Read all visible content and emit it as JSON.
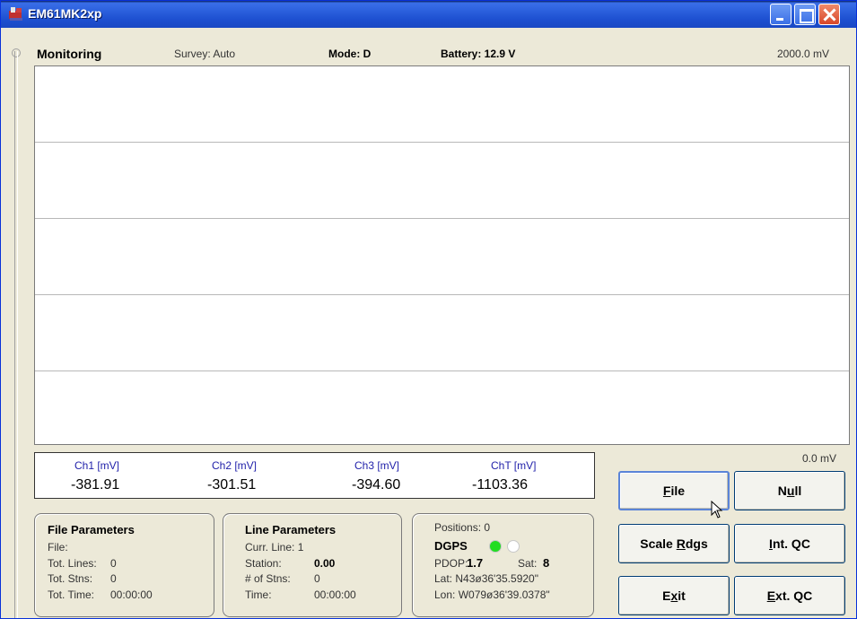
{
  "window": {
    "title": "EM61MK2xp"
  },
  "status": {
    "title": "Monitoring",
    "survey": "Survey: Auto",
    "mode": "Mode: D",
    "battery": "Battery: 12.9 V",
    "scale_max": "2000.0 mV",
    "scale_min": "0.0 mV"
  },
  "channels": [
    {
      "label": "Ch1 [mV]",
      "value": "-381.91"
    },
    {
      "label": "Ch2 [mV]",
      "value": "-301.51"
    },
    {
      "label": "Ch3 [mV]",
      "value": "-394.60"
    },
    {
      "label": "ChT [mV]",
      "value": "-1103.36"
    }
  ],
  "file_params": {
    "title": "File Parameters",
    "file_label": "File:",
    "tot_lines_label": "Tot. Lines:",
    "tot_lines_value": "0",
    "tot_stns_label": "Tot. Stns:",
    "tot_stns_value": "0",
    "tot_time_label": "Tot. Time:",
    "tot_time_value": "00:00:00"
  },
  "line_params": {
    "title": "Line Parameters",
    "curr_line": "Curr. Line: 1",
    "station_label": "Station:",
    "station_value": "0.00",
    "num_stns_label": "# of Stns:",
    "num_stns_value": "0",
    "time_label": "Time:",
    "time_value": "00:00:00"
  },
  "gps": {
    "positions": "Positions: 0",
    "dgps_label": "DGPS",
    "pdop_label": "PDOP:",
    "pdop_value": "1.7",
    "sat_label": "Sat:",
    "sat_value": "8",
    "lat": "Lat: N43ø36'35.5920\"",
    "lon": "Lon: W079ø36'39.0378\"",
    "status_colors": [
      "#22dd22",
      "#ffffff"
    ]
  },
  "buttons": {
    "file": {
      "pre": "",
      "ul": "F",
      "post": "ile"
    },
    "null": {
      "pre": "N",
      "ul": "u",
      "post": "ll"
    },
    "scale": {
      "pre": "Scale ",
      "ul": "R",
      "post": "dgs"
    },
    "intqc": {
      "pre": "",
      "ul": "I",
      "post": "nt. QC"
    },
    "exit": {
      "pre": "E",
      "ul": "x",
      "post": "it"
    },
    "extqc": {
      "pre": "",
      "ul": "E",
      "post": "xt. QC"
    }
  }
}
